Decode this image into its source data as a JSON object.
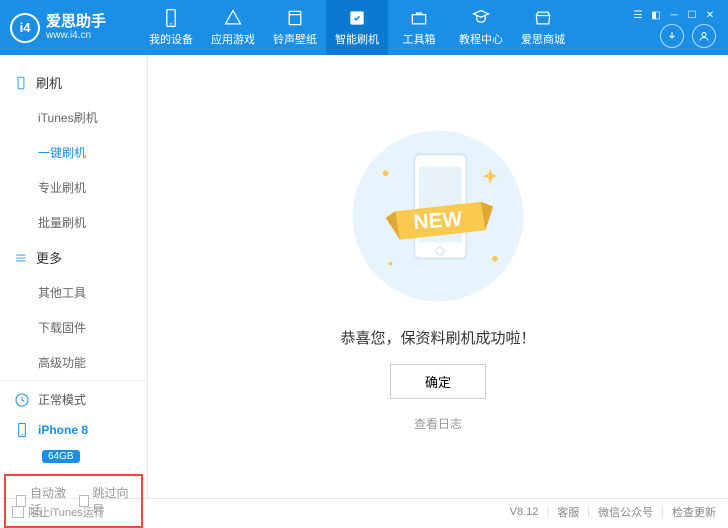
{
  "brand": {
    "name": "爱思助手",
    "url": "www.i4.cn",
    "logo_letters": "i4"
  },
  "tabs": [
    {
      "label": "我的设备"
    },
    {
      "label": "应用游戏"
    },
    {
      "label": "铃声壁纸"
    },
    {
      "label": "智能刷机",
      "active": true
    },
    {
      "label": "工具箱"
    },
    {
      "label": "教程中心"
    },
    {
      "label": "爱思商城"
    }
  ],
  "sidebar": {
    "group1": {
      "title": "刷机",
      "items": [
        {
          "label": "iTunes刷机"
        },
        {
          "label": "一键刷机",
          "active": true
        },
        {
          "label": "专业刷机"
        },
        {
          "label": "批量刷机"
        }
      ]
    },
    "group2": {
      "title": "更多",
      "items": [
        {
          "label": "其他工具"
        },
        {
          "label": "下载固件"
        },
        {
          "label": "高级功能"
        }
      ]
    },
    "mode": "正常模式",
    "device": {
      "name": "iPhone 8",
      "storage": "64GB"
    },
    "checks": {
      "auto_activate": "自动激活",
      "skip_guide": "跳过向导"
    }
  },
  "main": {
    "message": "恭喜您，保资料刷机成功啦！",
    "ok": "确定",
    "log": "查看日志",
    "ribbon": "NEW"
  },
  "footer": {
    "block_itunes": "阻止iTunes运行",
    "version": "V8.12",
    "support": "客服",
    "wechat": "微信公众号",
    "update": "检查更新"
  }
}
